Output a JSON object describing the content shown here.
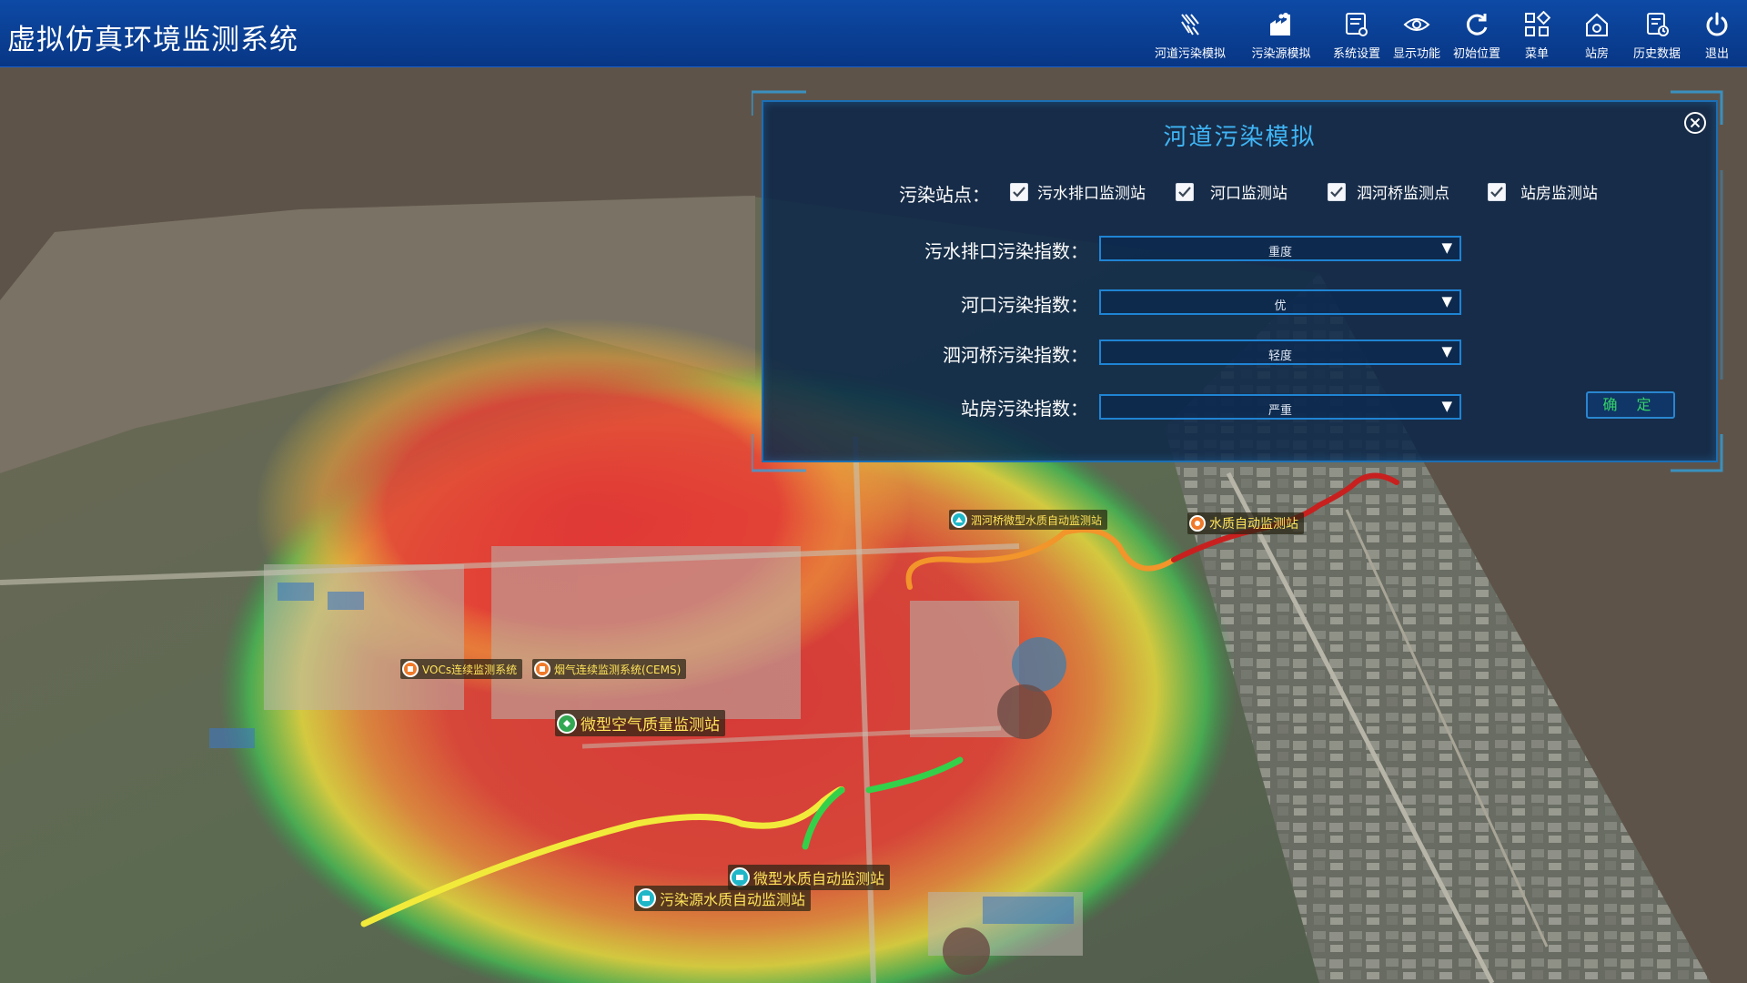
{
  "app": {
    "title": "虚拟仿真环境监测系统"
  },
  "toolbar": [
    {
      "key": "river",
      "label": "河道污染模拟",
      "icon": "river-pollution-icon"
    },
    {
      "key": "source",
      "label": "污染源模拟",
      "icon": "factory-icon"
    },
    {
      "key": "settings",
      "label": "系统设置",
      "icon": "settings-document-icon"
    },
    {
      "key": "display",
      "label": "显示功能",
      "icon": "eye-icon"
    },
    {
      "key": "reset",
      "label": "初始位置",
      "icon": "refresh-icon"
    },
    {
      "key": "menu",
      "label": "菜单",
      "icon": "grid-menu-icon"
    },
    {
      "key": "station",
      "label": "站房",
      "icon": "house-icon"
    },
    {
      "key": "history",
      "label": "历史数据",
      "icon": "history-document-icon"
    },
    {
      "key": "exit",
      "label": "退出",
      "icon": "power-icon"
    }
  ],
  "panel": {
    "title": "河道污染模拟",
    "stations_label": "污染站点：",
    "stations": [
      {
        "label": "污水排口监测站",
        "checked": true
      },
      {
        "label": "河口监测站",
        "checked": true
      },
      {
        "label": "泗河桥监测点",
        "checked": true
      },
      {
        "label": "站房监测站",
        "checked": true
      }
    ],
    "indices": [
      {
        "label": "污水排口污染指数：",
        "value": "重度"
      },
      {
        "label": "河口污染指数：",
        "value": "优"
      },
      {
        "label": "泗河桥污染指数：",
        "value": "轻度"
      },
      {
        "label": "站房污染指数：",
        "value": "严重"
      }
    ],
    "confirm_label": "确 定"
  },
  "map_labels": [
    {
      "text": "泗河桥微型水质自动监测站",
      "pin": "water-quality-pin-icon",
      "color": "#1fb7c8"
    },
    {
      "text": "水质自动监测站",
      "pin": "warning-pin-icon",
      "color": "#f07a2a"
    },
    {
      "text": "VOCs连续监测系统",
      "pin": "voc-pin-icon",
      "color": "#f07a2a"
    },
    {
      "text": "烟气连续监测系统(CEMS)",
      "pin": "cems-pin-icon",
      "color": "#f07a2a"
    },
    {
      "text": "微型空气质量监测站",
      "pin": "air-quality-pin-icon",
      "color": "#33a853"
    },
    {
      "text": "微型水质自动监测站",
      "pin": "water-station-pin-icon",
      "color": "#1fb7c8"
    },
    {
      "text": "污染源水质自动监测站",
      "pin": "source-water-pin-icon",
      "color": "#1fb7c8"
    }
  ],
  "colors": {
    "topbar": "#0a3f93",
    "panel_title": "#3fb5f5",
    "confirm_text": "#35d26a",
    "heat_high": "#e83a3a",
    "heat_mid": "#f2e33a",
    "heat_low": "#2fbd4a"
  }
}
